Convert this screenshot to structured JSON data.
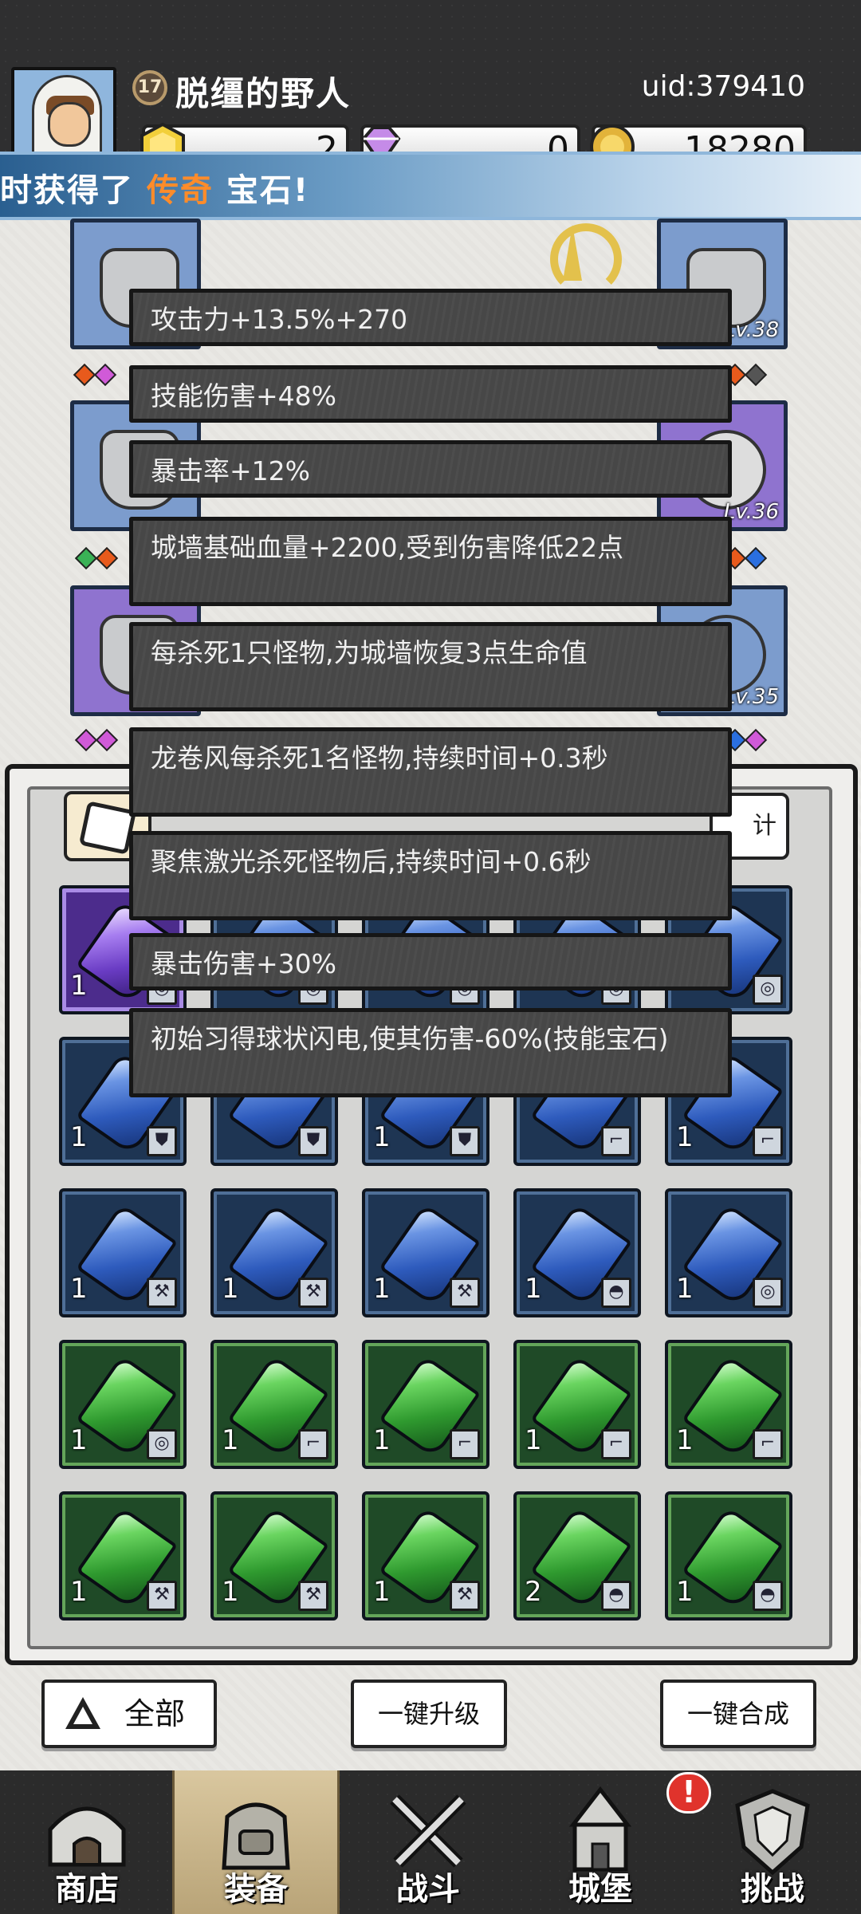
{
  "player": {
    "level": "17",
    "name": "脱缰的野人",
    "uid": "uid:379410"
  },
  "currencies": [
    {
      "icon": "gold-shield-icon",
      "amount": "2",
      "color": "#f2cf3a"
    },
    {
      "icon": "purple-diamond-icon",
      "amount": "0",
      "color": "#c58be8"
    },
    {
      "icon": "gold-coin-icon",
      "amount": "18280",
      "color": "#e2b33a"
    }
  ],
  "marquee": {
    "prefix": "时获得了",
    "highlight": "传奇",
    "suffix": "宝石!"
  },
  "equipment": {
    "right_levels": [
      "Lv.38",
      "Lv.36",
      "Lv.35"
    ]
  },
  "tooltip": {
    "lines": [
      "攻击力+13.5%+270",
      "技能伤害+48%",
      "暴击率+12%",
      "城墙基础血量+2200,受到伤害降低22点",
      "每杀死1只怪物,为城墙恢复3点生命值",
      "龙卷风每杀死1名怪物,持续时间+0.3秒",
      "聚焦激光杀死怪物后,持续时间+0.6秒",
      "暴击伤害+30%",
      "初始习得球状闪电,使其伤害-60%(技能宝石)"
    ]
  },
  "inventory": {
    "stats_tab_label": "计",
    "gems": [
      {
        "rarity": "purple",
        "count": "1",
        "slot": "ring-icon"
      },
      {
        "rarity": "blue",
        "count": "",
        "slot": "ring-icon"
      },
      {
        "rarity": "blue",
        "count": "",
        "slot": "ring-icon"
      },
      {
        "rarity": "blue",
        "count": "",
        "slot": "ring-icon"
      },
      {
        "rarity": "blue",
        "count": "",
        "slot": "ring-icon"
      },
      {
        "rarity": "blue",
        "count": "1",
        "slot": "armor-icon"
      },
      {
        "rarity": "blue",
        "count": "",
        "slot": "armor-icon"
      },
      {
        "rarity": "blue",
        "count": "1",
        "slot": "armor-icon"
      },
      {
        "rarity": "blue",
        "count": "",
        "slot": "boot-icon"
      },
      {
        "rarity": "blue",
        "count": "1",
        "slot": "boot-icon"
      },
      {
        "rarity": "blue",
        "count": "1",
        "slot": "weapon-icon"
      },
      {
        "rarity": "blue",
        "count": "1",
        "slot": "weapon-icon"
      },
      {
        "rarity": "blue",
        "count": "1",
        "slot": "weapon-icon"
      },
      {
        "rarity": "blue",
        "count": "1",
        "slot": "helmet-icon"
      },
      {
        "rarity": "blue",
        "count": "1",
        "slot": "ring-icon"
      },
      {
        "rarity": "green",
        "count": "1",
        "slot": "ring-icon"
      },
      {
        "rarity": "green",
        "count": "1",
        "slot": "boot-icon"
      },
      {
        "rarity": "green",
        "count": "1",
        "slot": "boot-icon"
      },
      {
        "rarity": "green",
        "count": "1",
        "slot": "boot-icon"
      },
      {
        "rarity": "green",
        "count": "1",
        "slot": "boot-icon"
      },
      {
        "rarity": "green",
        "count": "1",
        "slot": "weapon-icon"
      },
      {
        "rarity": "green",
        "count": "1",
        "slot": "weapon-icon"
      },
      {
        "rarity": "green",
        "count": "1",
        "slot": "weapon-icon"
      },
      {
        "rarity": "green",
        "count": "2",
        "slot": "helmet-icon"
      },
      {
        "rarity": "green",
        "count": "1",
        "slot": "helmet-icon"
      }
    ]
  },
  "actions": {
    "all": "全部",
    "upgrade": "一键升级",
    "merge": "一键合成"
  },
  "nav": {
    "items": [
      {
        "label": "商店",
        "icon": "shop-icon"
      },
      {
        "label": "装备",
        "icon": "backpack-icon"
      },
      {
        "label": "战斗",
        "icon": "crossed-swords-icon"
      },
      {
        "label": "城堡",
        "icon": "castle-icon"
      },
      {
        "label": "挑战",
        "icon": "shield-challenge-icon"
      }
    ],
    "badge": "!"
  }
}
